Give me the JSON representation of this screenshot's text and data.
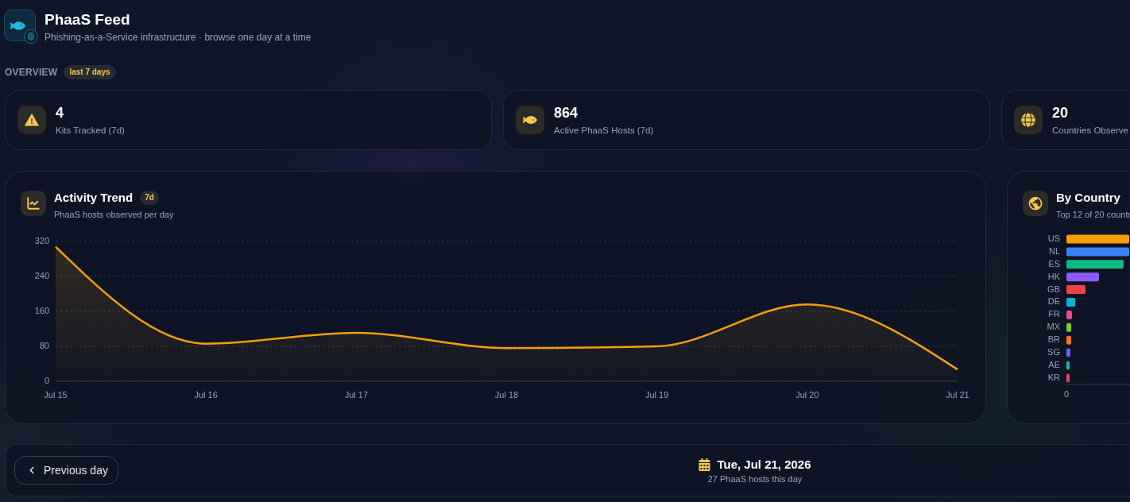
{
  "header": {
    "title": "PhaaS Feed",
    "subtitle": "Phishing-as-a-Service infrastructure · browse one day at a time"
  },
  "overview": {
    "label": "OVERVIEW",
    "badge": "last 7 days"
  },
  "stats": [
    {
      "kind": "warning",
      "value": "4",
      "label": "Kits Tracked (7d)"
    },
    {
      "kind": "fish",
      "value": "864",
      "label": "Active PhaaS Hosts (7d)"
    },
    {
      "kind": "globe",
      "value": "20",
      "label": "Countries Observe"
    }
  ],
  "activity_trend": {
    "title": "Activity Trend",
    "badge": "7d",
    "subtitle": "PhaaS hosts observed per day",
    "chart_data": {
      "type": "area",
      "categories": [
        "Jul 15",
        "Jul 16",
        "Jul 17",
        "Jul 18",
        "Jul 19",
        "Jul 20",
        "Jul 21"
      ],
      "series": [
        {
          "color": "#f59e0b",
          "values": [
            308,
            86,
            111,
            76,
            80,
            176,
            27
          ]
        }
      ],
      "ylim": [
        0,
        320
      ],
      "yticks": [
        0,
        80,
        160,
        240,
        320
      ],
      "grid": true
    }
  },
  "by_country": {
    "title": "By Country",
    "subtitle": "Top 12 of 20 countr",
    "countries": [
      {
        "label": "US",
        "color": "#f59e0b"
      },
      {
        "label": "NL",
        "color": "#3b82f6"
      },
      {
        "label": "ES",
        "color": "#10b981"
      },
      {
        "label": "HK",
        "color": "#8b5cf6"
      },
      {
        "label": "GB",
        "color": "#ef4444"
      },
      {
        "label": "DE",
        "color": "#06b6d4"
      },
      {
        "label": "FR",
        "color": "#ec4899"
      },
      {
        "label": "MX",
        "color": "#84cc16"
      },
      {
        "label": "BR",
        "color": "#f97316"
      },
      {
        "label": "SG",
        "color": "#6366f1"
      },
      {
        "label": "AE",
        "color": "#14b8a6"
      },
      {
        "label": "KR",
        "color": "#f43f5e"
      }
    ],
    "axis_tick": "0"
  },
  "day_nav": {
    "previous_button": "Previous day",
    "date": "Tue, Jul 21, 2026",
    "summary": "27 PhaaS hosts this day"
  }
}
